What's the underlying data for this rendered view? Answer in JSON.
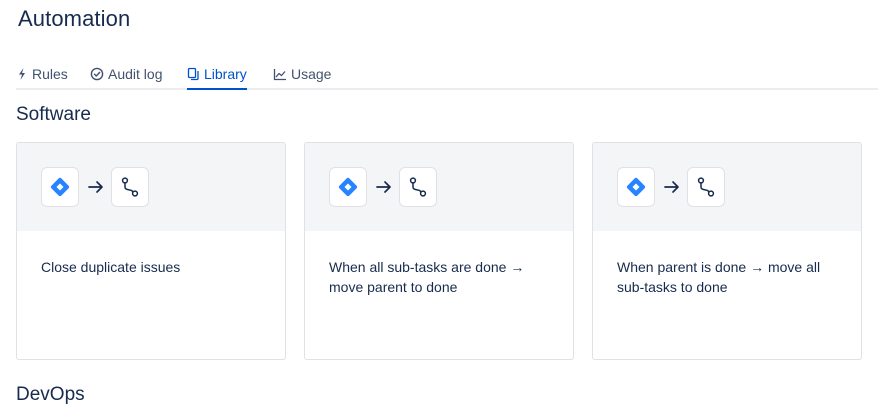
{
  "page": {
    "title": "Automation"
  },
  "tabs": [
    {
      "label": "Rules",
      "icon": "bolt-icon",
      "active": false
    },
    {
      "label": "Audit log",
      "icon": "check-circle-icon",
      "active": false
    },
    {
      "label": "Library",
      "icon": "copy-icon",
      "active": true
    },
    {
      "label": "Usage",
      "icon": "chart-line-icon",
      "active": false
    }
  ],
  "sections": [
    {
      "title": "Software",
      "cards": [
        {
          "text": "Close duplicate issues",
          "icons": [
            "jira-trigger-icon",
            "arrow-right-icon",
            "branch-action-icon"
          ]
        },
        {
          "text": "When all sub-tasks are done → move parent to done",
          "icons": [
            "jira-trigger-icon",
            "arrow-right-icon",
            "branch-action-icon"
          ]
        },
        {
          "text": "When parent is done → move all sub-tasks to done",
          "icons": [
            "jira-trigger-icon",
            "arrow-right-icon",
            "branch-action-icon"
          ]
        }
      ]
    },
    {
      "title": "DevOps",
      "cards": []
    }
  ],
  "colors": {
    "accent": "#0052cc",
    "text": "#172b4d",
    "muted": "#42526e",
    "border": "#dfe1e6",
    "card_header_bg": "#f4f5f7",
    "jira_blue": "#2684ff"
  }
}
